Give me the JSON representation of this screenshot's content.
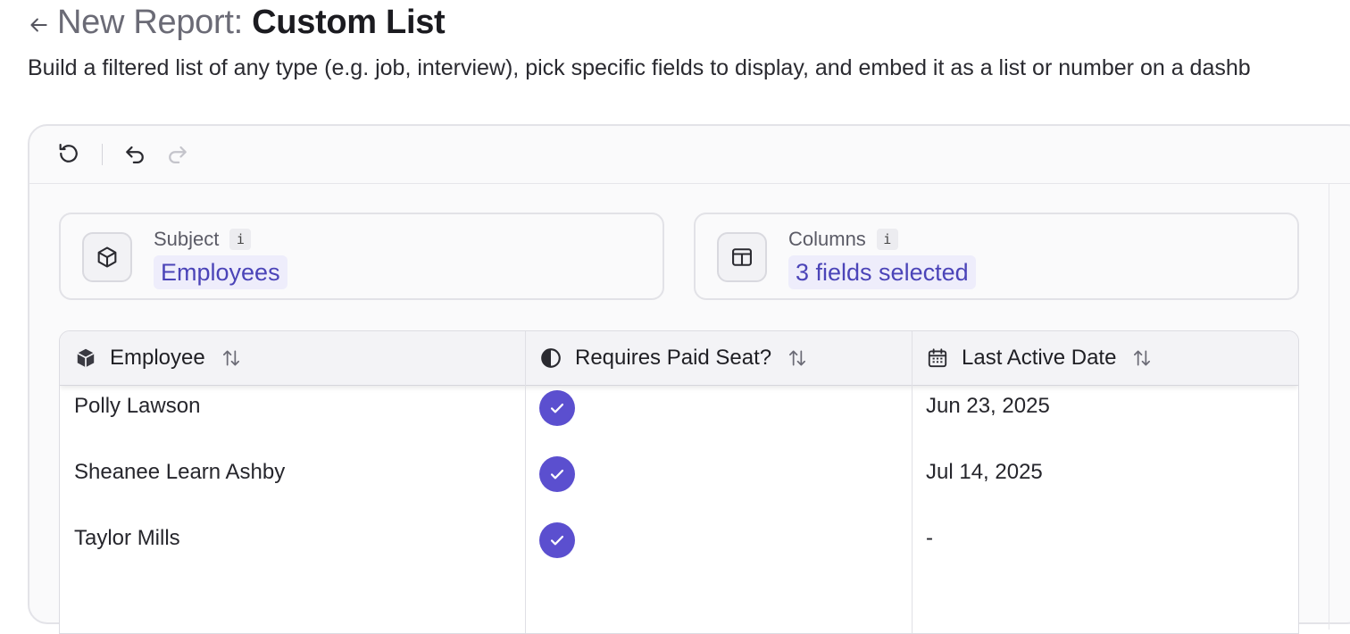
{
  "header": {
    "title_prefix": "New Report: ",
    "title_main": "Custom List",
    "subtitle": "Build a filtered list of any type (e.g. job, interview), pick specific fields to display, and embed it as a list or number on a dashb"
  },
  "toolbar": {
    "icons": [
      "reset-icon",
      "undo-icon",
      "redo-icon"
    ]
  },
  "subject": {
    "label": "Subject",
    "info": "i",
    "value": "Employees"
  },
  "columns_picker": {
    "label": "Columns",
    "info": "i",
    "value": "3 fields selected"
  },
  "table": {
    "headers": [
      "Employee",
      "Requires Paid Seat?",
      "Last Active Date"
    ],
    "rows": [
      {
        "employee": "Polly Lawson",
        "paid_seat": true,
        "last_active": "Jun 23, 2025"
      },
      {
        "employee": "Sheanee Learn Ashby",
        "paid_seat": true,
        "last_active": "Jul 14, 2025"
      },
      {
        "employee": "Taylor Mills",
        "paid_seat": true,
        "last_active": "-"
      }
    ]
  },
  "colors": {
    "accent": "#5b4fcf",
    "link_text": "#4b44b8",
    "link_bg": "#eeedfb"
  }
}
